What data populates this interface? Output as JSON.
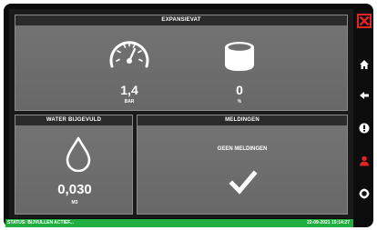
{
  "expansievat": {
    "title": "EXPANSIEVAT",
    "pressure_value": "1,4",
    "pressure_unit": "BAR",
    "tank_value": "0",
    "tank_unit": "%"
  },
  "water": {
    "title": "WATER BIJGEVULD",
    "value": "0,030",
    "unit": "M3"
  },
  "meldingen": {
    "title": "MELDINGEN",
    "message": "GEEN MELDINGEN"
  },
  "statusbar": {
    "left": "STATUS: BIJVULLEN ACTIEF...",
    "right": "22-09-2021 15:14:27"
  },
  "sidebar": {
    "icons": [
      "close-stop-icon",
      "home-icon",
      "back-arrow-icon",
      "info-icon",
      "user-icon",
      "settings-gear-icon"
    ]
  },
  "colors": {
    "accent_red": "#e22424",
    "status_green": "#1fae3f",
    "panel_gray": "#6f6f6f",
    "header_dark": "#2b2b2b"
  }
}
